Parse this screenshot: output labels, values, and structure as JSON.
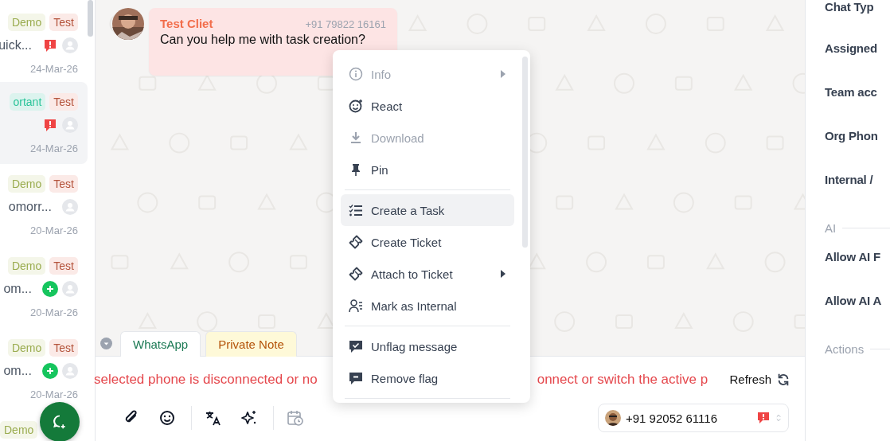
{
  "conversation_list": {
    "items": [
      {
        "tags": [
          {
            "label": "Demo",
            "kind": "demo"
          },
          {
            "label": "Test",
            "kind": "test"
          }
        ],
        "preview": "uick...",
        "flagged": true,
        "new": false,
        "date": "24-Mar-26",
        "selected": false
      },
      {
        "tags": [
          {
            "label": "ortant",
            "kind": "important"
          },
          {
            "label": "Test",
            "kind": "test"
          }
        ],
        "flagged": true,
        "new": false,
        "date": "24-Mar-26",
        "selected": true
      },
      {
        "tags": [
          {
            "label": "Demo",
            "kind": "demo"
          },
          {
            "label": "Test",
            "kind": "test"
          }
        ],
        "preview": "omorr...",
        "flagged": false,
        "new": false,
        "date": "20-Mar-26",
        "selected": false
      },
      {
        "tags": [
          {
            "label": "Demo",
            "kind": "demo"
          },
          {
            "label": "Test",
            "kind": "test"
          }
        ],
        "preview": "om...",
        "flagged": false,
        "new": true,
        "date": "20-Mar-26",
        "selected": false
      },
      {
        "tags": [
          {
            "label": "Demo",
            "kind": "demo"
          },
          {
            "label": "Test",
            "kind": "test"
          }
        ],
        "preview": "om...",
        "flagged": false,
        "new": true,
        "date": "20-Mar-26",
        "selected": false
      },
      {
        "tags": [
          {
            "label": "Demo",
            "kind": "demo"
          }
        ],
        "selected": false
      }
    ]
  },
  "message": {
    "sender": "Test Cliet",
    "phone": "+91 79822 16161",
    "text": "Can you help me with task creation?"
  },
  "context_menu": {
    "items": [
      {
        "kind": "item",
        "label": "Info",
        "disabled": true,
        "selected": false,
        "submenu": true
      },
      {
        "kind": "item",
        "label": "React",
        "disabled": false,
        "selected": false,
        "submenu": false
      },
      {
        "kind": "item",
        "label": "Download",
        "disabled": true,
        "selected": false,
        "submenu": false
      },
      {
        "kind": "item",
        "label": "Pin",
        "disabled": false,
        "selected": false,
        "submenu": false
      },
      {
        "kind": "divider"
      },
      {
        "kind": "item",
        "label": "Create a Task",
        "disabled": false,
        "selected": true,
        "submenu": false
      },
      {
        "kind": "item",
        "label": "Create Ticket",
        "disabled": false,
        "selected": false,
        "submenu": false
      },
      {
        "kind": "item",
        "label": "Attach to Ticket",
        "disabled": false,
        "selected": false,
        "submenu": true
      },
      {
        "kind": "item",
        "label": "Mark as Internal",
        "disabled": false,
        "selected": false,
        "submenu": false
      },
      {
        "kind": "divider"
      },
      {
        "kind": "item",
        "label": "Unflag message",
        "disabled": false,
        "selected": false,
        "submenu": false
      },
      {
        "kind": "item",
        "label": "Remove flag",
        "disabled": false,
        "selected": false,
        "submenu": false
      },
      {
        "kind": "divider"
      }
    ]
  },
  "composer": {
    "tabs": [
      {
        "label": "WhatsApp",
        "kind": "whatsapp",
        "selected": true
      },
      {
        "label": "Private Note",
        "kind": "note",
        "selected": false
      }
    ],
    "error_parts": [
      "selected phone is disconnected or no",
      "onnect or switch the active p"
    ],
    "refresh": "Refresh",
    "toolbar": [
      {
        "kind": "attach",
        "disabled": false
      },
      {
        "kind": "emoji",
        "disabled": false
      },
      {
        "kind": "divider"
      },
      {
        "kind": "translate",
        "disabled": false
      },
      {
        "kind": "ai",
        "disabled": false
      },
      {
        "kind": "divider"
      },
      {
        "kind": "schedule",
        "disabled": true
      }
    ],
    "phone_selector": {
      "number": "+91 92052 61116",
      "flagged": true
    }
  },
  "details_panel": {
    "fields": [
      "Chat Typ",
      "Assigned",
      "Team acc",
      "Org Phon",
      "Internal /"
    ],
    "sections": [
      {
        "title": "AI",
        "fields": [
          "Allow AI F",
          "Allow AI A"
        ]
      },
      {
        "title": "Actions"
      }
    ]
  }
}
